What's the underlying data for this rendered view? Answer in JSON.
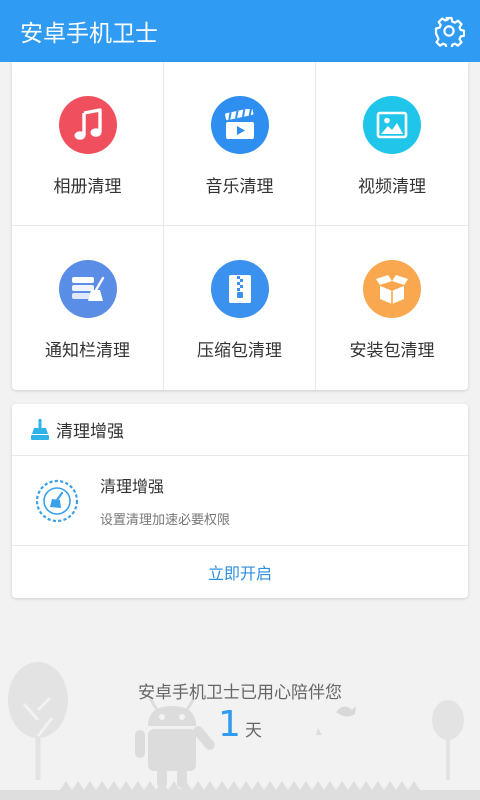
{
  "appbar": {
    "title": "安卓手机卫士",
    "settings_icon": "gear-icon"
  },
  "tiles": [
    {
      "label": "相册清理",
      "icon": "music-note-icon",
      "color": "#f0505d"
    },
    {
      "label": "音乐清理",
      "icon": "video-clapper-icon",
      "color": "#2e8ff0"
    },
    {
      "label": "视频清理",
      "icon": "image-icon",
      "color": "#20c6ea"
    },
    {
      "label": "通知栏清理",
      "icon": "notification-broom-icon",
      "color": "#5a8de6"
    },
    {
      "label": "压缩包清理",
      "icon": "zip-archive-icon",
      "color": "#3a92ee"
    },
    {
      "label": "安装包清理",
      "icon": "open-box-icon",
      "color": "#f9a84f"
    }
  ],
  "enhance": {
    "header_title": "清理增强",
    "row_title": "清理增强",
    "row_subtitle": "设置清理加速必要权限",
    "action_label": "立即开启"
  },
  "footer": {
    "companion_text": "安卓手机卫士已用心陪伴您",
    "days_value": "1",
    "days_unit": "天"
  },
  "colors": {
    "primary": "#2f9bf2",
    "background": "#f2f2f2",
    "card": "#ffffff",
    "link": "#2f8fe0"
  }
}
